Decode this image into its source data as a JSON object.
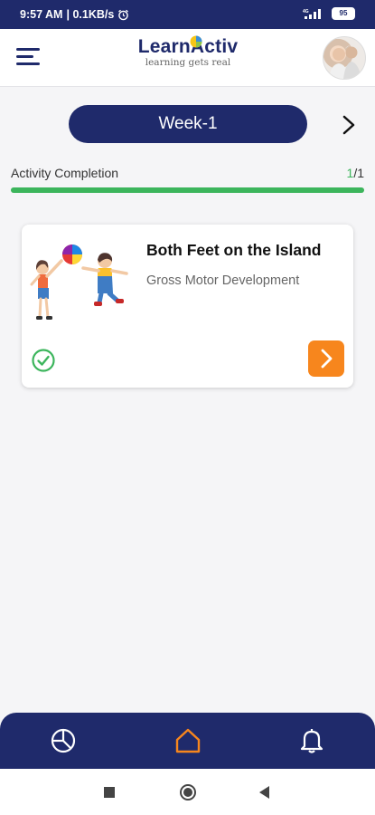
{
  "status_bar": {
    "time": "9:57 AM",
    "network_speed": "| 0.1KB/s",
    "battery": "95",
    "alarm_icon": "alarm-icon",
    "signal_icon": "signal-icon"
  },
  "header": {
    "brand_learn": "Learn",
    "brand_activ": "Activ",
    "tagline": "learning gets real",
    "menu_icon": "hamburger-menu-icon",
    "avatar_icon": "profile-avatar"
  },
  "week": {
    "label": "Week-1",
    "next_icon": "chevron-right-icon"
  },
  "completion": {
    "label": "Activity Completion",
    "done": "1",
    "total": "/1",
    "progress_fraction": 1.0,
    "color": "#3cb55c"
  },
  "activities": [
    {
      "title": "Both Feet on the Island",
      "category": "Gross Motor Development",
      "status_icon": "check-circle-icon",
      "action_icon": "chevron-right-icon"
    }
  ],
  "bottom_nav": {
    "items": [
      "pie-chart-icon",
      "home-icon",
      "bell-icon"
    ],
    "active": "home-icon",
    "active_color": "#f7861d"
  },
  "colors": {
    "primary": "#1f2a6b",
    "accent": "#f7861d",
    "success": "#3cb55c"
  }
}
